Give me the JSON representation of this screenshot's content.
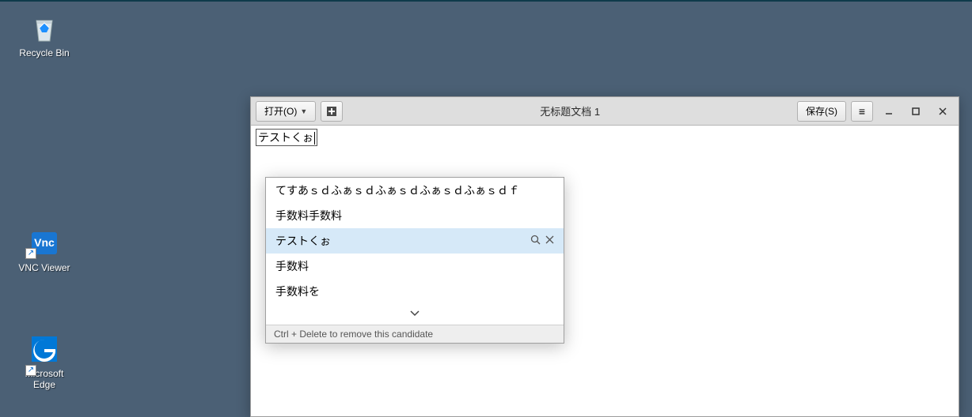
{
  "desktop": {
    "icons": [
      {
        "name": "recycle-bin",
        "label": "Recycle Bin"
      },
      {
        "name": "vnc-viewer",
        "label": "VNC Viewer"
      },
      {
        "name": "microsoft-edge",
        "label": "Microsoft Edge"
      }
    ]
  },
  "editor": {
    "open_label": "打开(O)",
    "save_label": "保存(S)",
    "title": "无标题文档 1",
    "preedit": "テストくぉ"
  },
  "ime": {
    "candidates": [
      {
        "text": "てすあｓｄふぁｓｄふぁｓｄふぁｓｄふぁｓｄｆ",
        "selected": false
      },
      {
        "text": "手数料手数料",
        "selected": false
      },
      {
        "text": "テストくぉ",
        "selected": true
      },
      {
        "text": "手数料",
        "selected": false
      },
      {
        "text": "手数料を",
        "selected": false
      }
    ],
    "hint": "Ctrl + Delete to remove this candidate"
  }
}
